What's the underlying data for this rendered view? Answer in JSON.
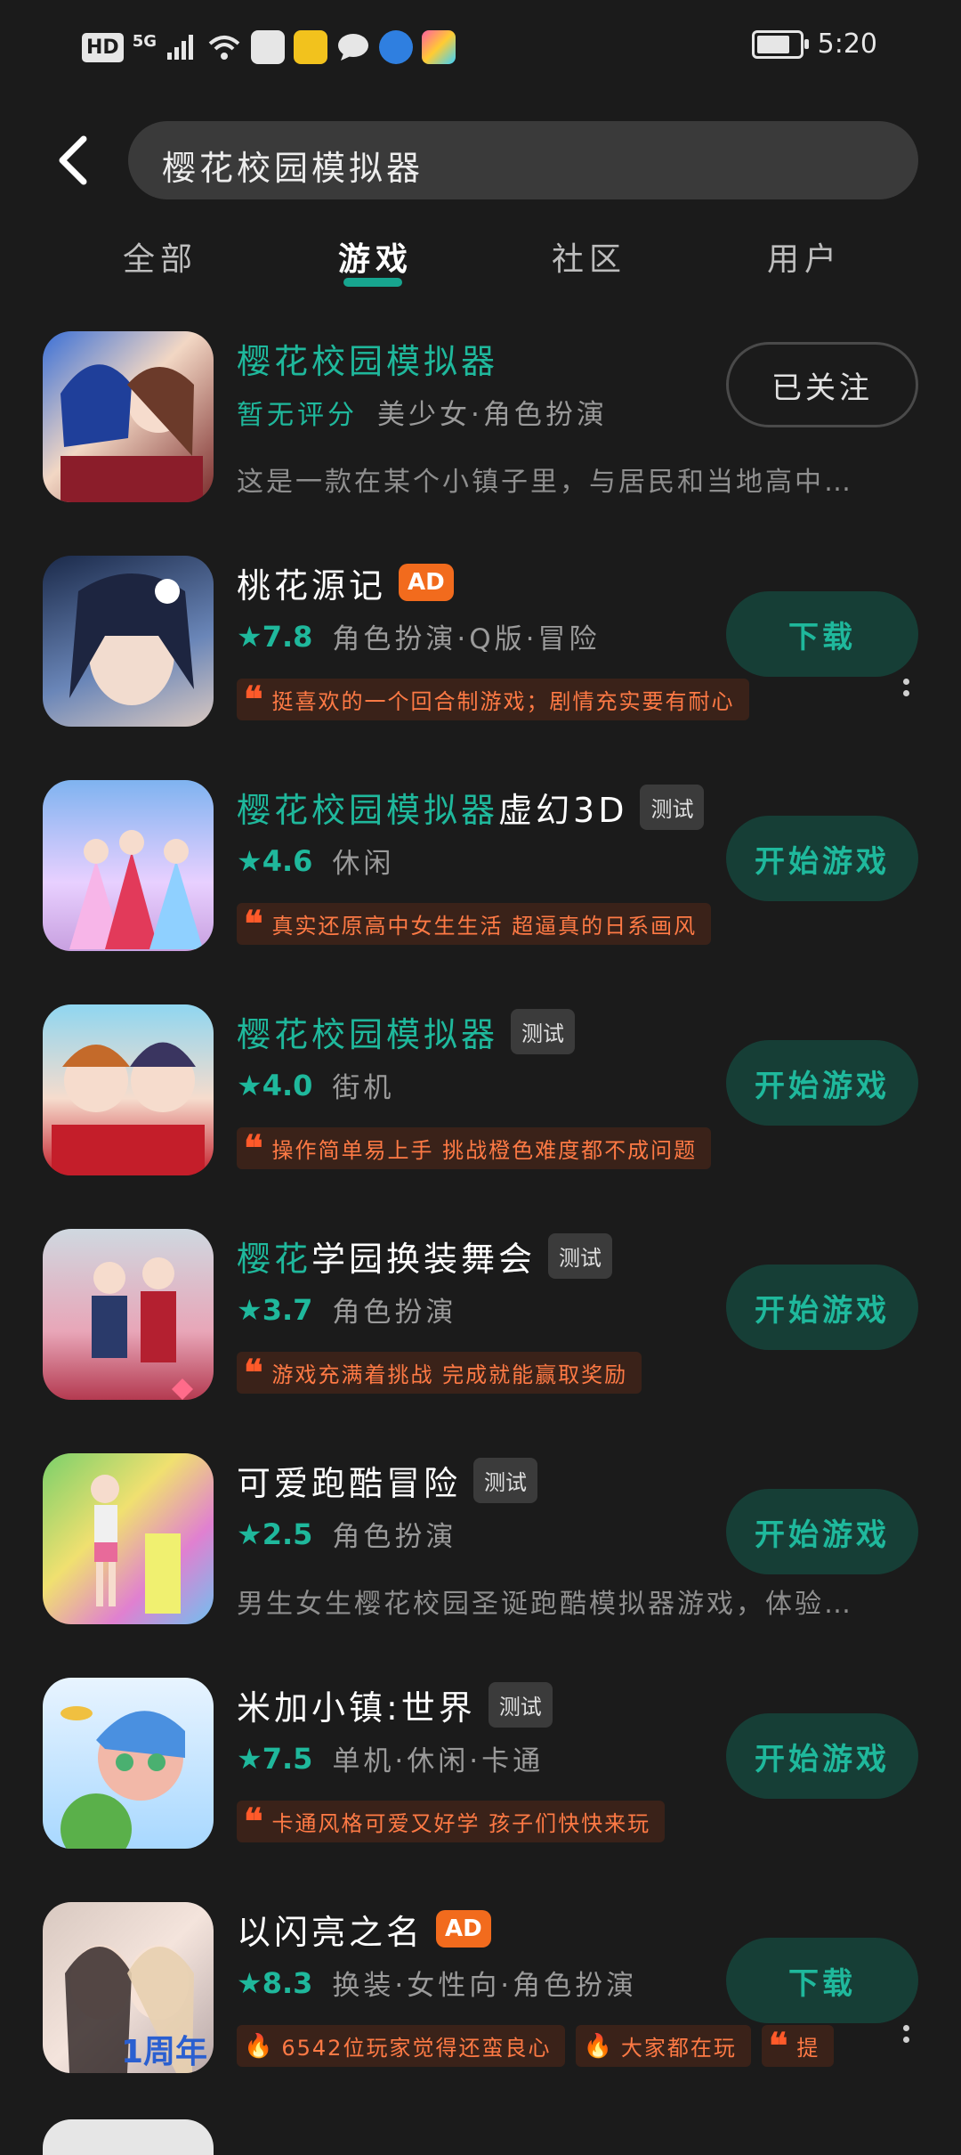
{
  "status_bar": {
    "hd": "HD",
    "network": "5G",
    "time": "5:20",
    "battery_level": 0.9,
    "icons": [
      "signal-icon",
      "wifi-icon",
      "app-notif-icon",
      "app-7-icon",
      "chat-icon",
      "browser-icon",
      "app-icon"
    ]
  },
  "search": {
    "query": "樱花校园模拟器"
  },
  "tabs": [
    {
      "label": "全部"
    },
    {
      "label": "游戏",
      "active": true
    },
    {
      "label": "社区"
    },
    {
      "label": "用户"
    }
  ],
  "results": [
    {
      "title": "樱花校园模拟器",
      "rating_text": "暂无评分",
      "tags": "美少女·角色扮演",
      "description": "这是一款在某个小镇子里，与居民和当地高中…",
      "button": "已关注"
    },
    {
      "title": "桃花源记",
      "badge": "AD",
      "rating": "7.8",
      "tags": "角色扮演·Q版·冒险",
      "quote": "挺喜欢的一个回合制游戏；剧情充实要有耐心",
      "button": "下载"
    },
    {
      "title_hl": "樱花校园模拟器",
      "title_rest": "虚幻3D",
      "badge": "测试",
      "rating": "4.6",
      "tags": "休闲",
      "quote": "真实还原高中女生生活 超逼真的日系画风",
      "button": "开始游戏"
    },
    {
      "title": "樱花校园模拟器",
      "badge": "测试",
      "rating": "4.0",
      "tags": "街机",
      "quote": "操作简单易上手 挑战橙色难度都不成问题",
      "button": "开始游戏"
    },
    {
      "title_hl": "樱花",
      "title_rest": "学园换装舞会",
      "badge": "测试",
      "rating": "3.7",
      "tags": "角色扮演",
      "quote": "游戏充满着挑战 完成就能赢取奖励",
      "button": "开始游戏"
    },
    {
      "title": "可爱跑酷冒险",
      "badge": "测试",
      "rating": "2.5",
      "tags": "角色扮演",
      "description": "男生女生樱花校园圣诞跑酷模拟器游戏，体验…",
      "button": "开始游戏"
    },
    {
      "title": "米加小镇:世界",
      "badge": "测试",
      "rating": "7.5",
      "tags": "单机·休闲·卡通",
      "quote": "卡通风格可爱又好学 孩子们快快来玩",
      "button": "开始游戏"
    },
    {
      "title": "以闪亮之名",
      "badge": "AD",
      "rating": "8.3",
      "tags": "换装·女性向·角色扮演",
      "quote_1": "6542位玩家觉得还蛮良心",
      "quote_2": "大家都在玩",
      "quote_3": "提",
      "button": "下载"
    }
  ],
  "colors": {
    "accent": "#1fb89c",
    "ad": "#f26b1d",
    "quote": "#ff7a45"
  }
}
